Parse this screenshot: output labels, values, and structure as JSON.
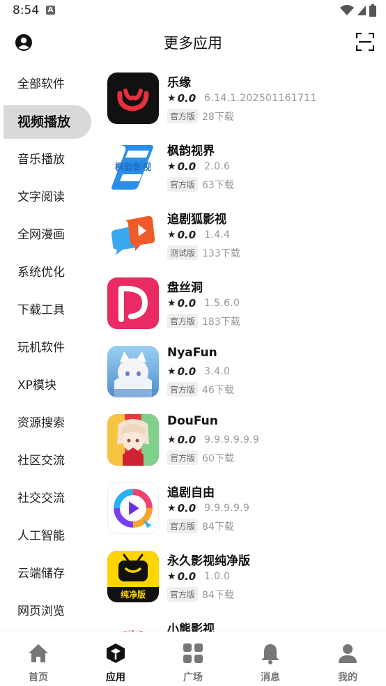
{
  "status_bar": {
    "time": "8:54",
    "a_badge": "A"
  },
  "header": {
    "title": "更多应用",
    "profile_icon": "profile-icon",
    "scan_icon": "scan-icon"
  },
  "sidebar": {
    "items": [
      {
        "label": "全部软件",
        "active": false
      },
      {
        "label": "视频播放",
        "active": true
      },
      {
        "label": "音乐播放",
        "active": false
      },
      {
        "label": "文字阅读",
        "active": false
      },
      {
        "label": "全网漫画",
        "active": false
      },
      {
        "label": "系统优化",
        "active": false
      },
      {
        "label": "下载工具",
        "active": false
      },
      {
        "label": "玩机软件",
        "active": false
      },
      {
        "label": "XP模块",
        "active": false
      },
      {
        "label": "资源搜索",
        "active": false
      },
      {
        "label": "社区交流",
        "active": false
      },
      {
        "label": "社交交流",
        "active": false
      },
      {
        "label": "人工智能",
        "active": false
      },
      {
        "label": "云端储存",
        "active": false
      },
      {
        "label": "网页浏览",
        "active": false
      }
    ]
  },
  "apps": [
    {
      "name": "乐缘",
      "rating": "0.0",
      "version": "6.14.1.202501161711",
      "badge": "官方版",
      "downloads": "28下载",
      "icon": "leyuan-icon"
    },
    {
      "name": "枫韵视界",
      "rating": "0.0",
      "version": "2.0.6",
      "badge": "官方版",
      "downloads": "63下载",
      "icon": "fengyun-icon",
      "icon_text": "枫韵影视"
    },
    {
      "name": "追剧狐影视",
      "rating": "0.0",
      "version": "1.4.4",
      "badge": "测试版",
      "downloads": "133下载",
      "icon": "zhuijuhu-icon"
    },
    {
      "name": "盘丝洞",
      "rating": "0.0",
      "version": "1.5.6.0",
      "badge": "官方版",
      "downloads": "183下载",
      "icon": "pansidong-icon"
    },
    {
      "name": "NyaFun",
      "rating": "0.0",
      "version": "3.4.0",
      "badge": "官方版",
      "downloads": "46下载",
      "icon": "nyafun-icon"
    },
    {
      "name": "DouFun",
      "rating": "0.0",
      "version": "9.9.9.9.9.9",
      "badge": "官方版",
      "downloads": "60下载",
      "icon": "doufun-icon"
    },
    {
      "name": "追剧自由",
      "rating": "0.0",
      "version": "9.9.9.9.9",
      "badge": "官方版",
      "downloads": "84下载",
      "icon": "zhujuziyou-icon"
    },
    {
      "name": "永久影视纯净版",
      "rating": "0.0",
      "version": "1.0.0",
      "badge": "官方版",
      "downloads": "84下载",
      "icon": "yongjiu-icon",
      "icon_text": "纯净版"
    },
    {
      "name": "小熊影视",
      "rating": "",
      "version": "",
      "badge": "",
      "downloads": "",
      "icon": "xiaoxiong-icon",
      "icon_text": "小熊影视"
    }
  ],
  "bottom_nav": [
    {
      "label": "首页",
      "icon": "home-icon",
      "active": false
    },
    {
      "label": "应用",
      "icon": "apps-cube-icon",
      "active": true
    },
    {
      "label": "广场",
      "icon": "grid-icon",
      "active": false
    },
    {
      "label": "消息",
      "icon": "bell-icon",
      "active": false
    },
    {
      "label": "我的",
      "icon": "user-icon",
      "active": false
    }
  ],
  "colors": {
    "active_sidebar_bg": "#d9d9d9",
    "nav_inactive": "#777777",
    "nav_active": "#111111"
  }
}
